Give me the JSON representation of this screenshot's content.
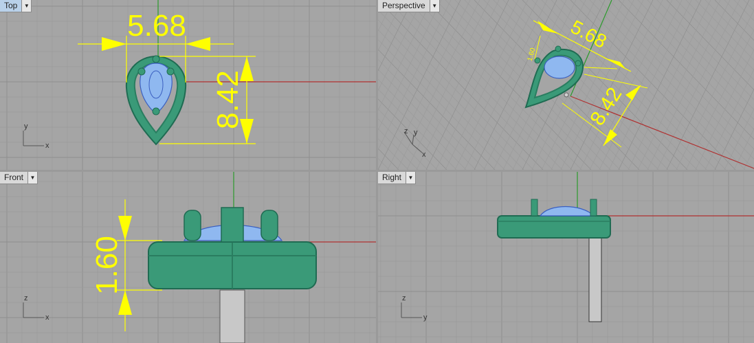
{
  "viewports": {
    "top": {
      "label": "Top",
      "dim_width": "5.68",
      "dim_height": "8.42",
      "axis_x": "x",
      "axis_y": "y"
    },
    "perspective": {
      "label": "Perspective",
      "dim_width": "5.68",
      "dim_height": "8.42",
      "dim_small": "1.60",
      "axis_x": "x",
      "axis_y": "y",
      "axis_z": "z"
    },
    "front": {
      "label": "Front",
      "dim_height": "1.60",
      "axis_x": "x",
      "axis_z": "z"
    },
    "right": {
      "label": "Right",
      "axis_y": "y",
      "axis_z": "z"
    }
  },
  "colors": {
    "background": "#a5a5a5",
    "grid_minor": "#9b9b9b",
    "grid_major": "#8e8e8e",
    "x_axis": "#b03030",
    "y_axis": "#2a9a2a",
    "dimension": "#ffff00",
    "model_green": "#3a9a78",
    "gem_blue": "#8fb8f0",
    "metal_post": "#d0d0d0",
    "active_tab": "#b9d1ea"
  }
}
